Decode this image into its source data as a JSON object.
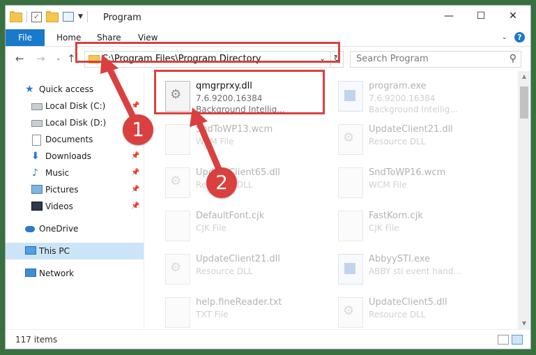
{
  "window": {
    "title": "Program",
    "controls": {
      "minimize": "—",
      "maximize": "☐",
      "close": "✕"
    }
  },
  "ribbon": {
    "file": "File",
    "tabs": [
      "Home",
      "Share",
      "View"
    ],
    "help": "?"
  },
  "address": {
    "path": "C:\\Program Files\\Program Directory",
    "refresh": "↻",
    "dropdown": "⌄"
  },
  "search": {
    "placeholder": "Search Program"
  },
  "nav": {
    "items": [
      {
        "label": "Quick access",
        "icon": "star-icon"
      },
      {
        "label": "Local Disk (C:)",
        "icon": "disk-icon",
        "pinned": true
      },
      {
        "label": "Local Disk (D:)",
        "icon": "disk-icon",
        "pinned": true
      },
      {
        "label": "Documents",
        "icon": "documents-icon",
        "pinned": true
      },
      {
        "label": "Downloads",
        "icon": "downloads-icon",
        "pinned": true
      },
      {
        "label": "Music",
        "icon": "music-icon",
        "pinned": true
      },
      {
        "label": "Pictures",
        "icon": "pictures-icon",
        "pinned": true
      },
      {
        "label": "Videos",
        "icon": "videos-icon",
        "pinned": true
      },
      {
        "label": "OneDrive",
        "icon": "onedrive-icon"
      },
      {
        "label": "This PC",
        "icon": "this-pc-icon",
        "selected": true
      },
      {
        "label": "Network",
        "icon": "network-icon"
      }
    ]
  },
  "files": [
    {
      "name": "qmgrprxy.dll",
      "line1": "7.6.9200.16384",
      "line2": "Background Intellig...",
      "icon": "dll-gear-icon",
      "highlighted": true
    },
    {
      "name": "program.exe",
      "line1": "7.6.9200.16384",
      "line2": "Background Intellig...",
      "icon": "exe-icon"
    },
    {
      "name": "SndToWP13.wcm",
      "line1": "WCM File",
      "icon": "file-icon"
    },
    {
      "name": "UpdateClient21.dll",
      "line1": "Resource DLL",
      "icon": "dll-gear-icon"
    },
    {
      "name": "UpdateClient65.dll",
      "line1": "Resource DLL",
      "icon": "dll-gear-icon"
    },
    {
      "name": "SndToWP16.wcm",
      "line1": "WCM File",
      "icon": "file-icon"
    },
    {
      "name": "DefaultFont.cjk",
      "line1": "CJK File",
      "icon": "file-icon"
    },
    {
      "name": "FastKorn.cjk",
      "line1": "CJK File",
      "icon": "file-icon"
    },
    {
      "name": "UpdateClient21.dll",
      "line1": "Resource DLL",
      "icon": "dll-gear-icon"
    },
    {
      "name": "AbbyySTI.exe",
      "line1": "ABBY sti event hand...",
      "icon": "exe-icon"
    },
    {
      "name": "help.fineReader.txt",
      "line1": "TXT File",
      "icon": "file-icon"
    },
    {
      "name": "UpdateClient5.dll",
      "line1": "Resource DLL",
      "icon": "dll-gear-icon"
    }
  ],
  "status": {
    "count": "117 items"
  },
  "callouts": {
    "one": "1",
    "two": "2"
  },
  "colors": {
    "accent": "#1979ca",
    "highlight": "#d9403f",
    "selected": "#cce4f7"
  }
}
